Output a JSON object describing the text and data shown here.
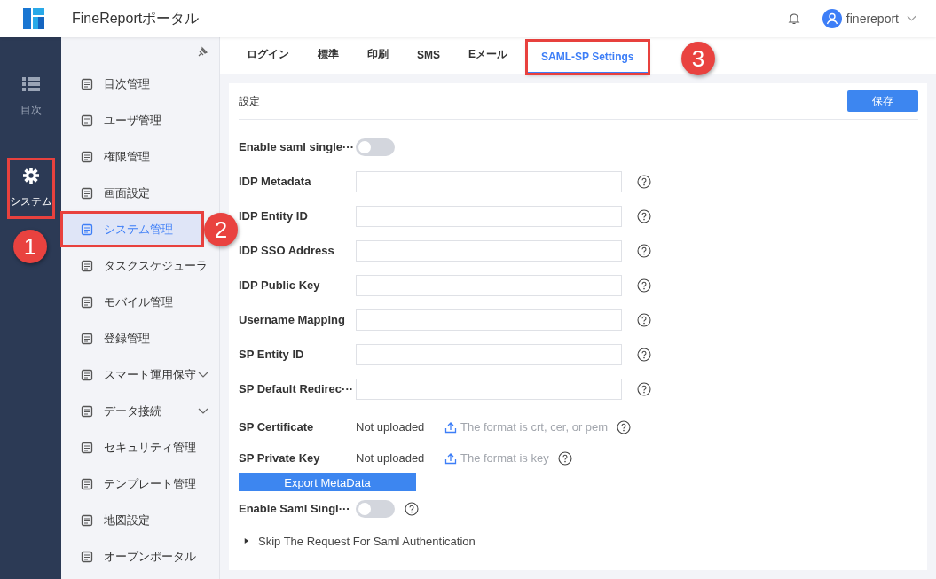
{
  "header": {
    "title": "FineReportポータル",
    "user": "finereport"
  },
  "rail": [
    {
      "label": "目次",
      "selected": false,
      "highlighted": false
    },
    {
      "label": "システム",
      "selected": true,
      "highlighted": true
    }
  ],
  "sidebar": {
    "items": [
      {
        "label": "目次管理",
        "selected": false,
        "highlighted": false
      },
      {
        "label": "ユーザ管理",
        "selected": false,
        "highlighted": false
      },
      {
        "label": "権限管理",
        "selected": false,
        "highlighted": false
      },
      {
        "label": "画面設定",
        "selected": false,
        "highlighted": false
      },
      {
        "label": "システム管理",
        "selected": true,
        "highlighted": true
      },
      {
        "label": "タスクスケジューラ",
        "selected": false,
        "highlighted": false
      },
      {
        "label": "モバイル管理",
        "selected": false,
        "highlighted": false
      },
      {
        "label": "登録管理",
        "selected": false,
        "highlighted": false
      },
      {
        "label": "スマート運用保守",
        "selected": false,
        "highlighted": false,
        "expandable": true,
        "expanded": false
      },
      {
        "label": "データ接続",
        "selected": false,
        "highlighted": false,
        "expandable": true,
        "expanded": false
      },
      {
        "label": "セキュリティ管理",
        "selected": false,
        "highlighted": false
      },
      {
        "label": "テンプレート管理",
        "selected": false,
        "highlighted": false
      },
      {
        "label": "地図設定",
        "selected": false,
        "highlighted": false
      },
      {
        "label": "オープンポータル",
        "selected": false,
        "highlighted": false
      }
    ]
  },
  "tabs": [
    {
      "label": "ログイン",
      "selected": false,
      "highlighted": false
    },
    {
      "label": "標準",
      "selected": false,
      "highlighted": false
    },
    {
      "label": "印刷",
      "selected": false,
      "highlighted": false
    },
    {
      "label": "SMS",
      "selected": false,
      "highlighted": false
    },
    {
      "label": "Eメール",
      "selected": false,
      "highlighted": false
    },
    {
      "label": "SAML-SP Settings",
      "selected": true,
      "highlighted": true
    }
  ],
  "panel": {
    "title": "設定",
    "save_button": "保存",
    "fields": [
      {
        "kind": "switch",
        "label": "Enable saml single···",
        "on": false,
        "help": false
      },
      {
        "kind": "input",
        "label": "IDP Metadata"
      },
      {
        "kind": "input",
        "label": "IDP Entity ID"
      },
      {
        "kind": "input",
        "label": "IDP SSO Address"
      },
      {
        "kind": "input",
        "label": "IDP Public Key"
      },
      {
        "kind": "input",
        "label": "Username Mapping"
      },
      {
        "kind": "input",
        "label": "SP Entity ID"
      },
      {
        "kind": "input",
        "label": "SP Default Redirec···"
      },
      {
        "kind": "upload",
        "label": "SP Certificate",
        "status": "Not uploaded",
        "hint": "The format is crt, cer, or pem"
      },
      {
        "kind": "upload",
        "label": "SP Private Key",
        "status": "Not uploaded",
        "hint": "The format is key"
      },
      {
        "kind": "button",
        "label": "Export MetaData"
      },
      {
        "kind": "switch",
        "label": "Enable Saml Singl···",
        "on": false,
        "help": true
      },
      {
        "kind": "expander",
        "label": "Skip The Request For Saml Authentication",
        "expanded": false
      }
    ]
  },
  "callouts": [
    {
      "number": "1"
    },
    {
      "number": "2"
    },
    {
      "number": "3"
    }
  ]
}
